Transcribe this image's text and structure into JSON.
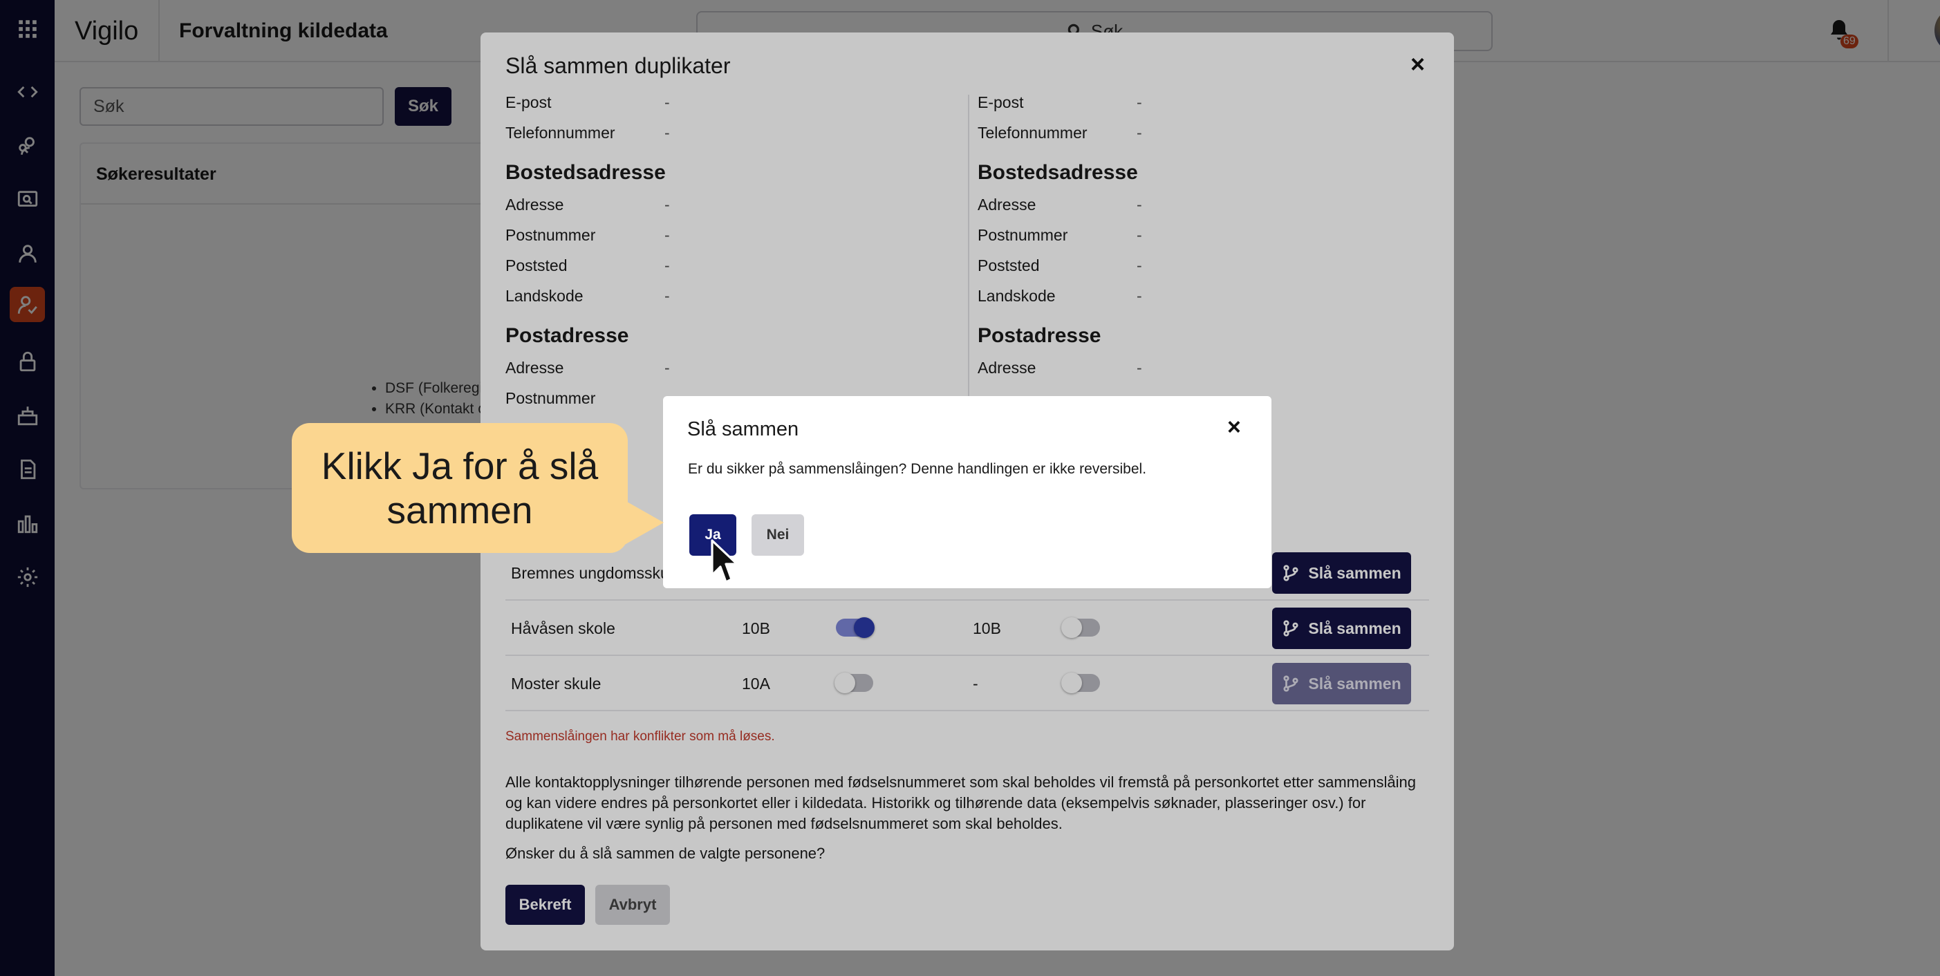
{
  "app": {
    "brand": "Vigilo",
    "module_title": "Forvaltning kildedata",
    "top_search_label": "Søk",
    "notification_count": "69"
  },
  "sidebar": {
    "items": [
      {
        "icon": "apps-grid-icon"
      },
      {
        "icon": "code-icon"
      },
      {
        "icon": "people-search-icon"
      },
      {
        "icon": "screen-search-icon"
      },
      {
        "icon": "person-icon"
      },
      {
        "icon": "person-check-icon",
        "active": true
      },
      {
        "icon": "lock-icon"
      },
      {
        "icon": "school-icon"
      },
      {
        "icon": "document-icon"
      },
      {
        "icon": "bar-chart-icon"
      },
      {
        "icon": "gear-icon"
      }
    ],
    "active_color": "#d9481d",
    "background": "#0e0d33"
  },
  "main": {
    "search_placeholder": "Søk",
    "search_button": "Søk",
    "results_title": "Søkeresultater",
    "results_list": [
      "DSF (Folkeregis",
      "KRR (Kontakt o"
    ]
  },
  "merge_modal": {
    "title": "Slå sammen duplikater",
    "close": "×",
    "left": {
      "contact": [
        {
          "label": "E-post",
          "value": "-"
        },
        {
          "label": "Telefonnummer",
          "value": "-"
        }
      ],
      "bosted_title": "Bostedsadresse",
      "bosted": [
        {
          "label": "Adresse",
          "value": "-"
        },
        {
          "label": "Postnummer",
          "value": "-"
        },
        {
          "label": "Poststed",
          "value": "-"
        },
        {
          "label": "Landskode",
          "value": "-"
        }
      ],
      "post_title": "Postadresse",
      "post": [
        {
          "label": "Adresse",
          "value": "-"
        },
        {
          "label": "Postnummer",
          "value": ""
        }
      ]
    },
    "right": {
      "contact": [
        {
          "label": "E-post",
          "value": "-"
        },
        {
          "label": "Telefonnummer",
          "value": "-"
        }
      ],
      "bosted_title": "Bostedsadresse",
      "bosted": [
        {
          "label": "Adresse",
          "value": "-"
        },
        {
          "label": "Postnummer",
          "value": "-"
        },
        {
          "label": "Poststed",
          "value": "-"
        },
        {
          "label": "Landskode",
          "value": "-"
        }
      ],
      "post_title": "Postadresse",
      "post": [
        {
          "label": "Adresse",
          "value": "-"
        }
      ]
    },
    "schools": [
      {
        "name": "Bremnes ungdomsskule",
        "class_left": "",
        "toggle_left": false,
        "class_right": "",
        "toggle_right": false,
        "button": "Slå sammen",
        "enabled": true
      },
      {
        "name": "Håvåsen skole",
        "class_left": "10B",
        "toggle_left": true,
        "class_right": "10B",
        "toggle_right": false,
        "button": "Slå sammen",
        "enabled": true
      },
      {
        "name": "Moster skule",
        "class_left": "10A",
        "toggle_left": false,
        "class_right": "-",
        "toggle_right": false,
        "button": "Slå sammen",
        "enabled": false
      }
    ],
    "conflict_text": "Sammenslåingen har konflikter som må løses.",
    "info_text": "Alle kontaktopplysninger tilhørende personen med fødselsnummeret som skal beholdes vil fremstå på personkortet etter sammenslåing og kan videre endres på personkortet eller i kildedata. Historikk og tilhørende data (eksempelvis søknader, plasseringer osv.) for duplikatene vil være synlig på personen med fødselsnummeret som skal beholdes.",
    "question": "Ønsker du å slå sammen de valgte personene?",
    "confirm_button": "Bekreft",
    "cancel_button": "Avbryt"
  },
  "confirm_dialog": {
    "title": "Slå sammen",
    "close": "×",
    "text": "Er du sikker på sammenslåingen? Denne handlingen er ikke reversibel.",
    "yes_button": "Ja",
    "no_button": "Nei"
  },
  "callout": {
    "text": "Klikk Ja for å slå sammen",
    "color": "#fbd690"
  }
}
